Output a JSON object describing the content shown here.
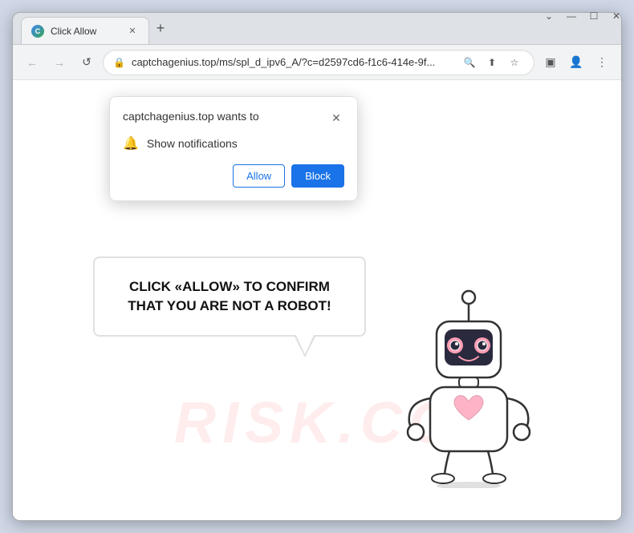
{
  "browser": {
    "tab": {
      "title": "Click Allow",
      "favicon": "C"
    },
    "new_tab_label": "+",
    "window_controls": {
      "minimize": "—",
      "maximize": "☐",
      "close": "✕",
      "chevron": "⌄"
    },
    "nav": {
      "back": "←",
      "forward": "→",
      "reload": "↺",
      "address": "captchagenius.top/ms/spl_d_ipv6_A/?c=d2597cd6-f1c6-414e-9f...",
      "lock": "🔒",
      "search_icon": "🔍",
      "share_icon": "⬆",
      "star_icon": "☆",
      "reading_icon": "▣",
      "profile_icon": "👤",
      "menu_icon": "⋮"
    }
  },
  "notification_popup": {
    "title": "captchagenius.top wants to",
    "close_btn": "✕",
    "notification_label": "Show notifications",
    "allow_btn": "Allow",
    "block_btn": "Block"
  },
  "page": {
    "captcha_message": "CLICK «ALLOW» TO CONFIRM THAT YOU ARE NOT A ROBOT!",
    "watermark": "RISK.CO"
  }
}
